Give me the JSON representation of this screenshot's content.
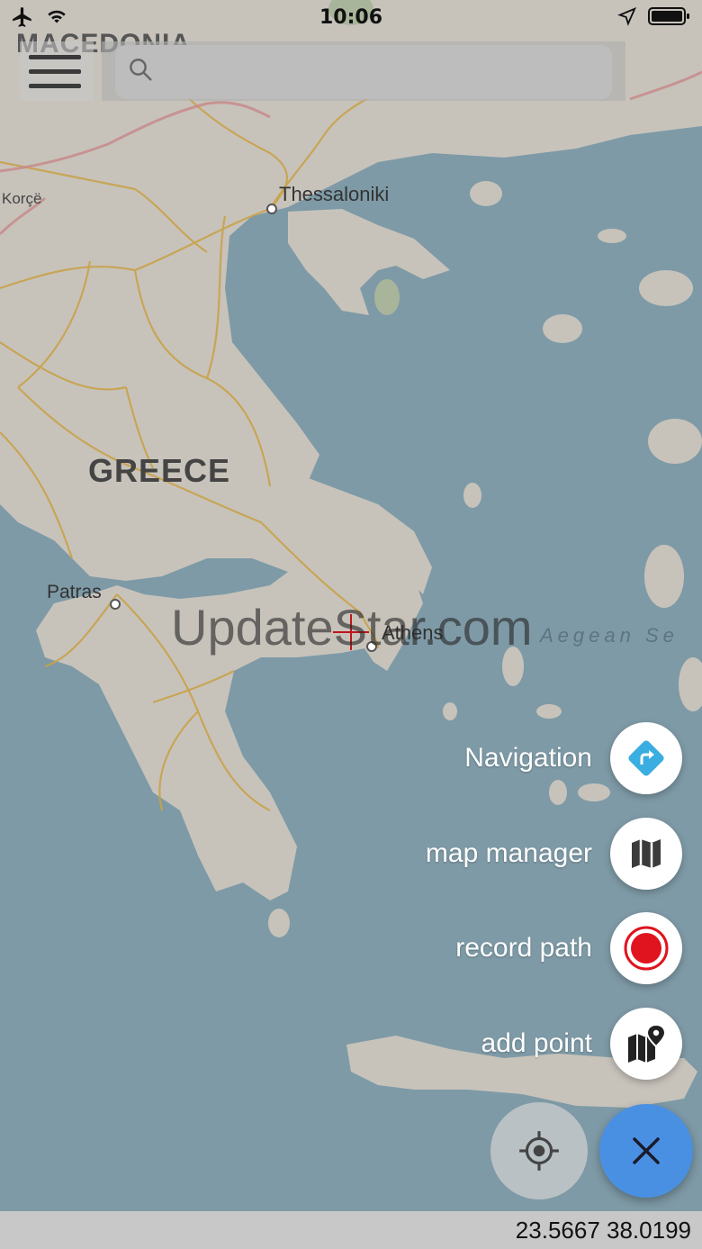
{
  "status_bar": {
    "time": "10:06",
    "icons": [
      "airplane-icon",
      "wifi-icon",
      "location-arrow-icon",
      "battery-icon"
    ]
  },
  "search": {
    "value": "",
    "placeholder": ""
  },
  "map": {
    "labels": {
      "macedonia": "MACEDONIA",
      "korce": "Korçë",
      "thessaloniki": "Thessaloniki",
      "greece": "GREECE",
      "patras": "Patras",
      "athens": "Athens",
      "aegean": "Aegean Se"
    },
    "colors": {
      "sea": "#7e9aa6",
      "land": "#c7c3bb",
      "roads": "#c9a24a",
      "borders": "#c78b8b"
    }
  },
  "watermark": "UpdateStar.com",
  "actions": [
    {
      "label": "Navigation",
      "icon": "navigation-icon"
    },
    {
      "label": "map manager",
      "icon": "map-icon"
    },
    {
      "label": "record path",
      "icon": "record-icon"
    },
    {
      "label": "add point",
      "icon": "add-point-icon"
    }
  ],
  "colors": {
    "accent": "#4a90e2",
    "navigation": "#3aaee0",
    "record": "#e0141e"
  },
  "coordinates": "23.5667 38.0199"
}
